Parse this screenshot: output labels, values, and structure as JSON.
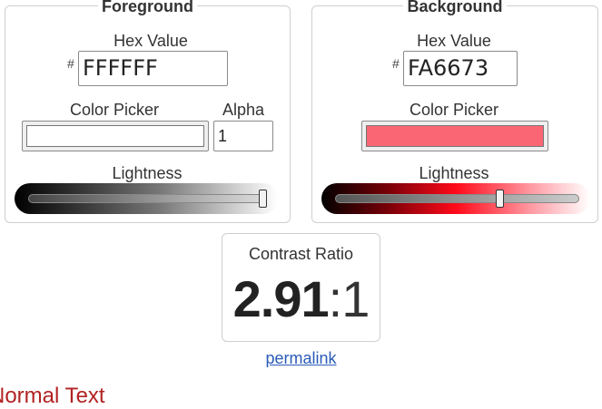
{
  "foreground": {
    "legend": "Foreground",
    "hex_label": "Hex Value",
    "hash": "#",
    "hex_value": "FFFFFF",
    "picker_label": "Color Picker",
    "alpha_label": "Alpha",
    "alpha_value": "1",
    "lightness_label": "Lightness",
    "color": "#FFFFFF",
    "lightness_fraction": 1.0
  },
  "background": {
    "legend": "Background",
    "hex_label": "Hex Value",
    "hash": "#",
    "hex_value": "FA6673",
    "picker_label": "Color Picker",
    "lightness_label": "Lightness",
    "color": "#FA6673",
    "lightness_fraction": 0.68
  },
  "contrast": {
    "title": "Contrast Ratio",
    "ratio_main": "2.91",
    "ratio_sep": ":",
    "ratio_tail": "1"
  },
  "permalink": "permalink",
  "sample": {
    "text": "Normal Text",
    "color": "#b22222"
  }
}
